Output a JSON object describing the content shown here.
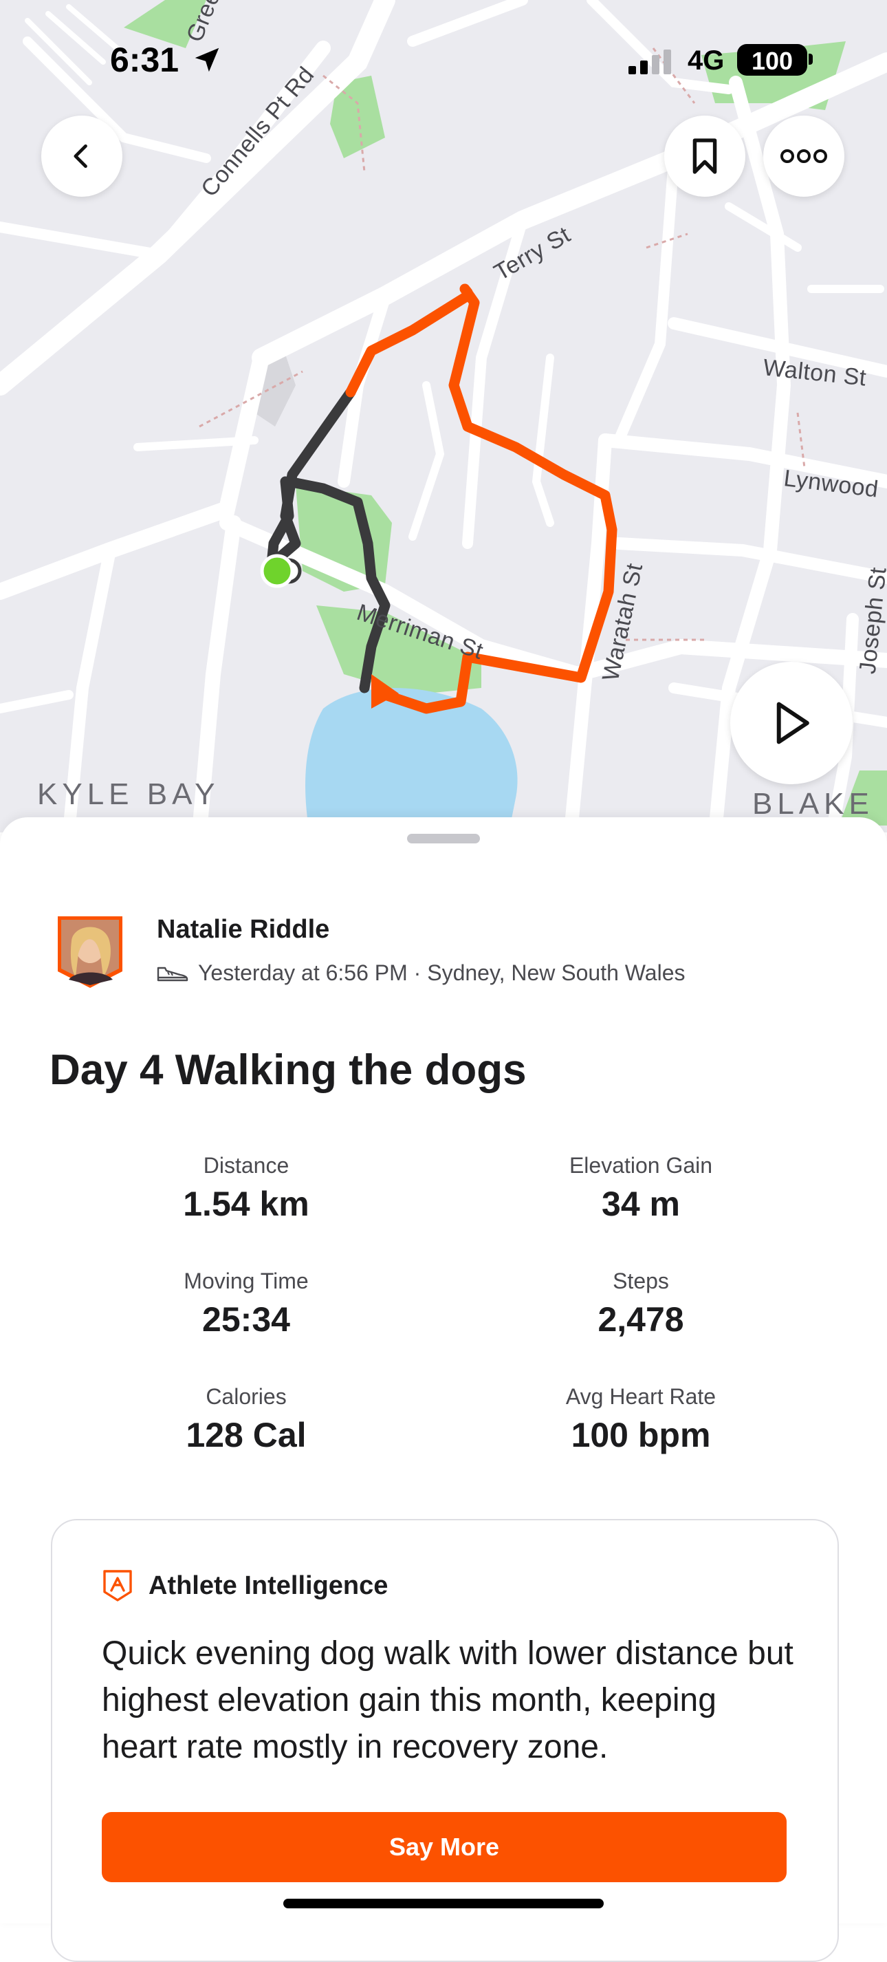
{
  "status_bar": {
    "time": "6:31",
    "network": "4G",
    "battery": "100"
  },
  "map": {
    "streets": [
      "Connells Pt Rd",
      "Terry St",
      "Walton St",
      "Lynwood",
      "Merriman St",
      "Waratah St",
      "Joseph St",
      "Gree"
    ],
    "areas": [
      "KYLE BAY",
      "BLAKE"
    ],
    "route_colors": {
      "done": "#fc5200",
      "remaining": "#3a3a3c",
      "start": "#6fd32c"
    },
    "buttons": {
      "back": "chevron-left-icon",
      "bookmark": "bookmark-icon",
      "more": "more-icon",
      "play": "play-icon"
    }
  },
  "activity": {
    "athlete": "Natalie Riddle",
    "meta": "Yesterday at 6:56 PM · Sydney, New South Wales",
    "title": "Day 4 Walking the dogs",
    "stats": [
      {
        "label": "Distance",
        "value": "1.54 km"
      },
      {
        "label": "Elevation Gain",
        "value": "34 m"
      },
      {
        "label": "Moving Time",
        "value": "25:34"
      },
      {
        "label": "Steps",
        "value": "2,478"
      },
      {
        "label": "Calories",
        "value": "128 Cal"
      },
      {
        "label": "Avg Heart Rate",
        "value": "100 bpm"
      }
    ]
  },
  "athlete_intelligence": {
    "heading": "Athlete Intelligence",
    "summary": "Quick evening dog walk with lower distance but highest elevation gain this month, keeping heart rate mostly in recovery zone.",
    "button_label": "Say More",
    "accent": "#fc5200"
  }
}
